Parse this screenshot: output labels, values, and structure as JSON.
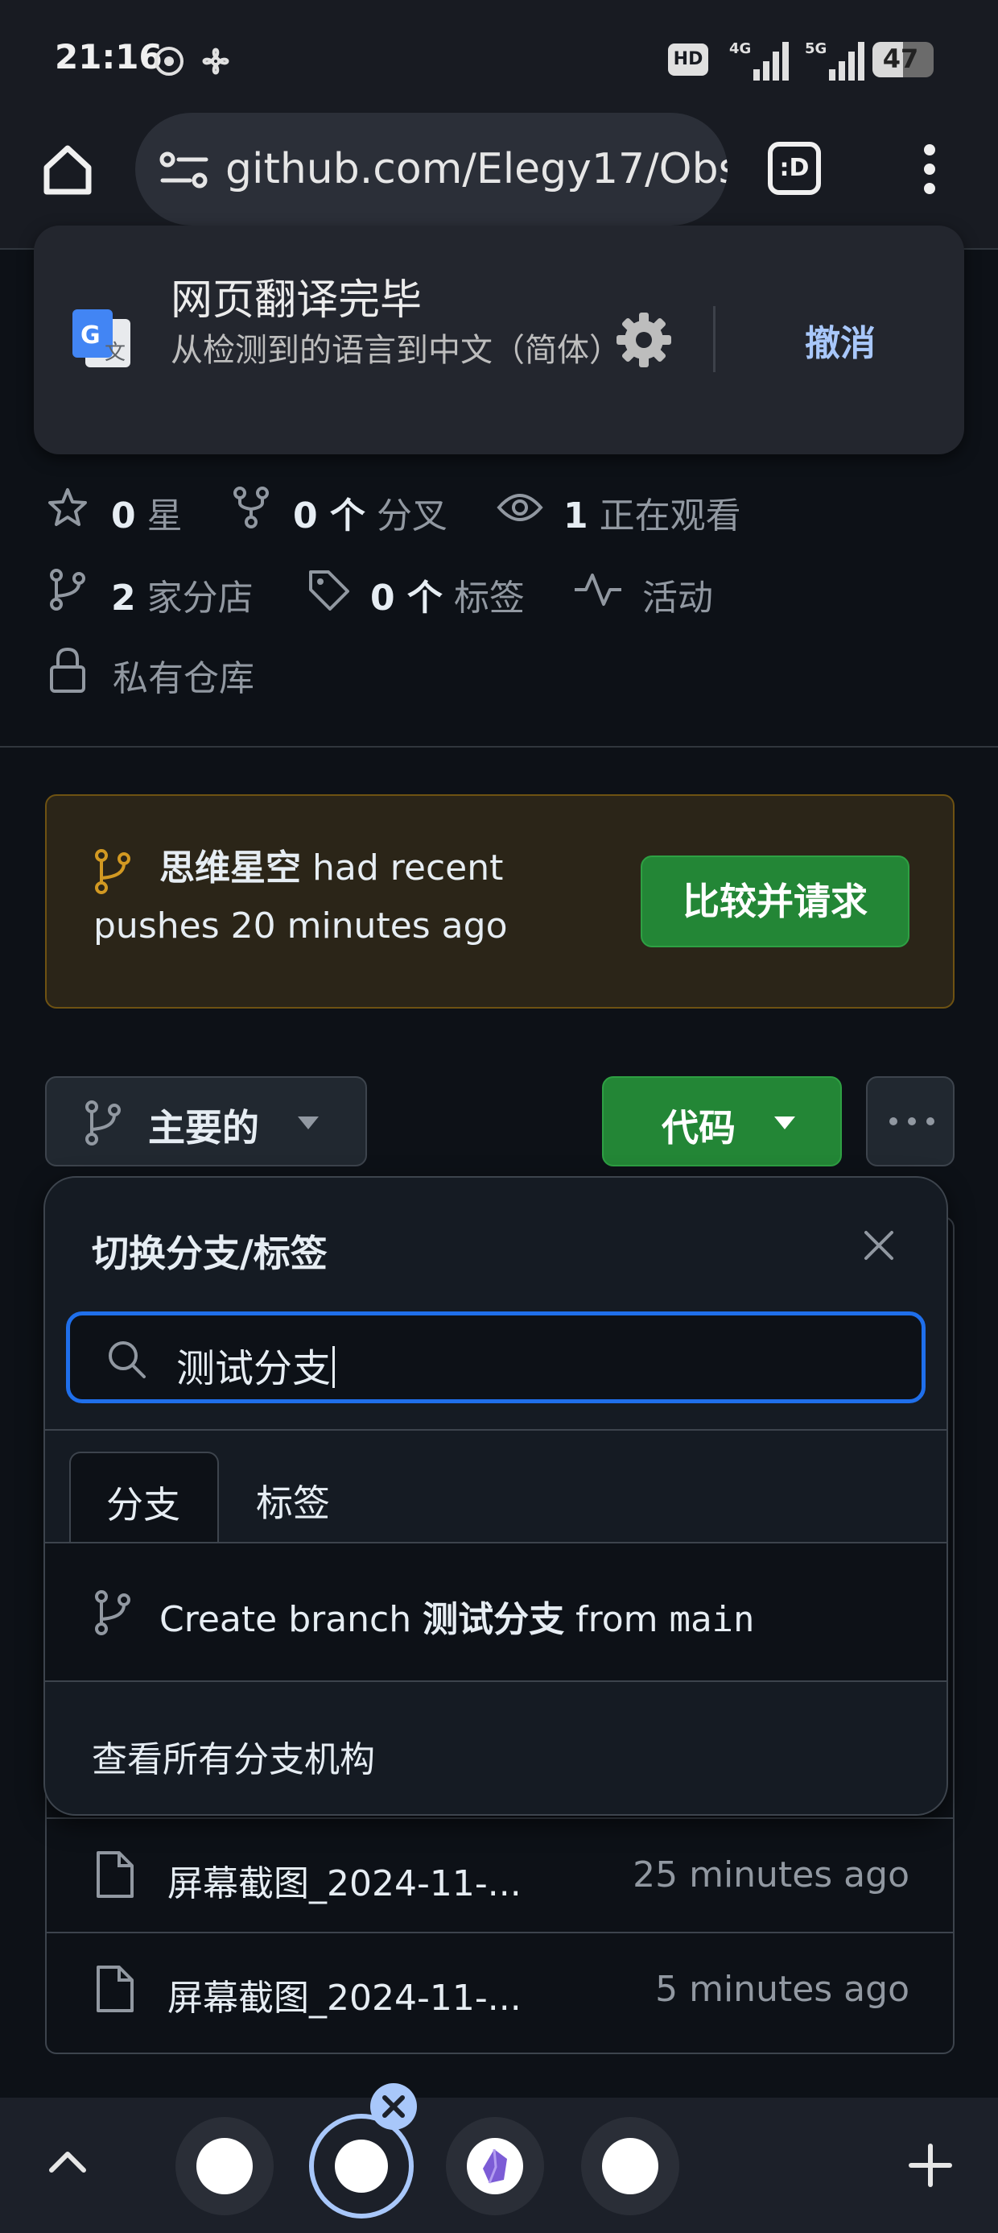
{
  "status_bar": {
    "time": "21:16",
    "battery": "47",
    "indicators": [
      "HD",
      "4G",
      "5G"
    ]
  },
  "browser": {
    "url": "github.com/Elegy17/Obs",
    "tab_switcher_label": ":D"
  },
  "translate_popup": {
    "title": "网页翻译完毕",
    "subtitle": "从检测到的语言到中文（简体）",
    "undo_label": "撤消"
  },
  "repo_meta": {
    "stars_count": "0",
    "stars_label": "星",
    "forks_count": "0 个",
    "forks_label": "分叉",
    "watching_count": "1",
    "watching_label": "正在观看",
    "branches_count": "2",
    "branches_label": "家分店",
    "tags_count": "0 个",
    "tags_label": "标签",
    "activity_label": "活动",
    "visibility_label": "私有仓库"
  },
  "push_banner": {
    "branch_name": "思维星空",
    "message": " had recent pushes 20 minutes ago",
    "compare_button": "比较并请求"
  },
  "toolbar": {
    "branch_button": "主要的",
    "code_button": "代码"
  },
  "branch_picker": {
    "title": "切换分支/标签",
    "search_value": "测试分支",
    "tabs": [
      {
        "label": "分支",
        "active": true
      },
      {
        "label": "标签",
        "active": false
      }
    ],
    "create_prefix": "Create branch ",
    "create_branch_name": "测试分支",
    "create_middle": " from ",
    "create_source": "main",
    "view_all_label": "查看所有分支机构"
  },
  "files": [
    {
      "name": "屏幕截图_2024-11-...",
      "time": "25 minutes ago"
    },
    {
      "name": "屏幕截图_2024-11-...",
      "time": "5 minutes ago"
    }
  ],
  "colors": {
    "background": "#0d1117",
    "primary_button": "#238636",
    "focus_border": "#1f6feb",
    "warning_border": "#6e5212",
    "link_blue": "#a8c7fa"
  }
}
